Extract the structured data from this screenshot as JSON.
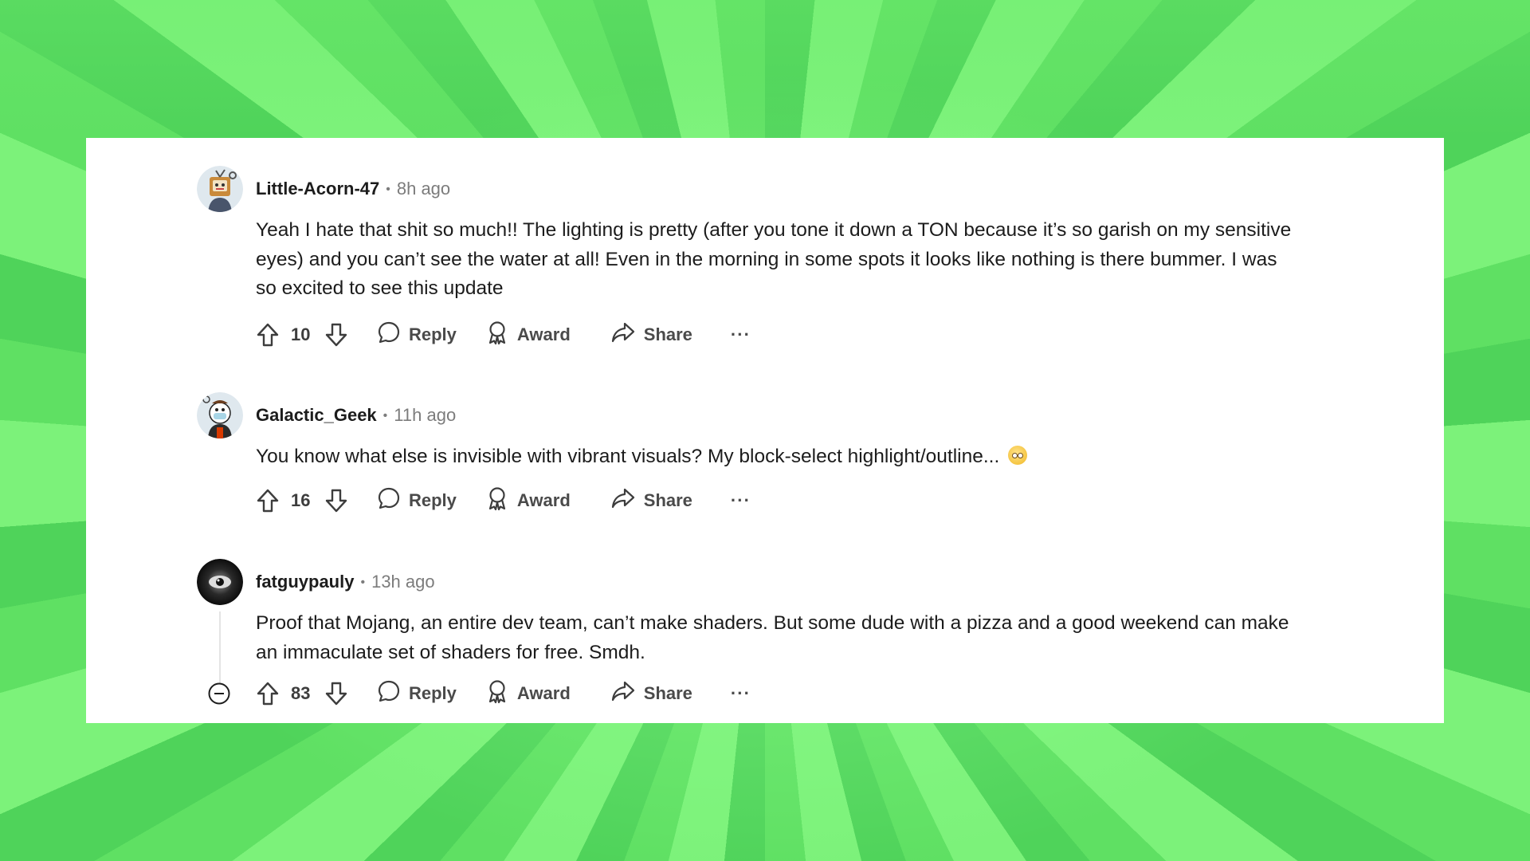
{
  "comments": [
    {
      "author": "Little-Acorn-47",
      "time": "8h ago",
      "body": "Yeah I hate that shit so much!! The lighting is pretty (after you tone it down a TON because it’s so garish on my sensitive eyes) and you can’t see the water at all! Even in the morning in some spots it looks like nothing is there bummer. I was so excited to see this update",
      "votes": "10",
      "reply": "Reply",
      "award": "Award",
      "share": "Share",
      "more": "···"
    },
    {
      "author": "Galactic_Geek",
      "time": "11h ago",
      "body": "You know what else is invisible with vibrant visuals? My block-select highlight/outline...",
      "votes": "16",
      "reply": "Reply",
      "award": "Award",
      "share": "Share",
      "more": "···"
    },
    {
      "author": "fatguypauly",
      "time": "13h ago",
      "body": "Proof that Mojang, an entire dev team, can’t make shaders. But some dude with a pizza and a good weekend can make an immaculate set of shaders for free. Smdh.",
      "votes": "83",
      "reply": "Reply",
      "award": "Award",
      "share": "Share",
      "more": "···"
    }
  ],
  "separator": "•",
  "colors": {
    "background_green": "#6ee86d",
    "card": "#ffffff",
    "text": "#1c1c1c",
    "meta": "#7c7c7c"
  },
  "icons": [
    "upvote-icon",
    "downvote-icon",
    "reply-bubble-icon",
    "award-icon",
    "share-arrow-icon",
    "collapse-icon",
    "rolling-eyes-emoji"
  ]
}
